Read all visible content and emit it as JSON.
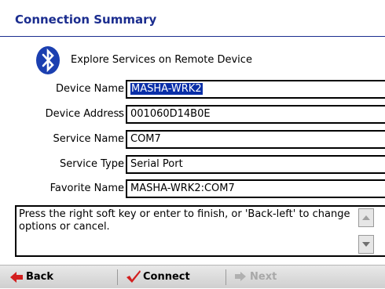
{
  "window": {
    "title": "Connection Summary"
  },
  "header": {
    "icon": "bluetooth-icon",
    "explore_text": "Explore Services on Remote Device"
  },
  "fields": [
    {
      "label": "Device Name",
      "value": "MASHA-WRK2",
      "selected": true
    },
    {
      "label": "Device Address",
      "value": "001060D14B0E",
      "selected": false
    },
    {
      "label": "Service Name",
      "value": "COM7",
      "selected": false
    },
    {
      "label": "Service Type",
      "value": "Serial Port",
      "selected": false
    },
    {
      "label": "Favorite Name",
      "value": "MASHA-WRK2:COM7",
      "selected": false
    }
  ],
  "message": {
    "text": "Press the right soft key or enter to finish, or 'Back-left' to change options or cancel."
  },
  "toolbar": {
    "back_label": "Back",
    "connect_label": "Connect",
    "next_label": "Next"
  },
  "colors": {
    "title": "#1b2d8f",
    "selection": "#0a2fa8",
    "bluetooth": "#1b3fb0",
    "back_arrow": "#d21f1f",
    "connect_check": "#d21f1f"
  }
}
